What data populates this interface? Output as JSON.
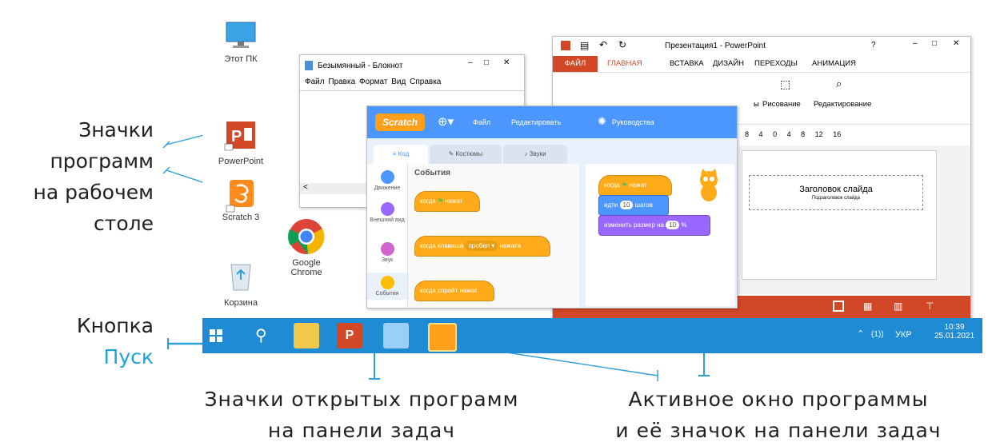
{
  "callouts": {
    "desktop_icons": [
      "Значки",
      "программ",
      "на рабочем",
      "столе"
    ],
    "start_button": [
      "Кнопка",
      "Пуск"
    ],
    "taskbar_icons": [
      "Значки открытых программ",
      "на панели задач"
    ],
    "active_window": [
      "Активное окно программы",
      "и её значок на панели задач"
    ]
  },
  "desktop": {
    "icons": [
      {
        "label": "Этот ПК",
        "icon": "computer-icon"
      },
      {
        "label": "PowerPoint",
        "icon": "powerpoint-icon"
      },
      {
        "label": "Scratch 3",
        "icon": "scratch-icon"
      },
      {
        "label": "Google Chrome",
        "icon": "chrome-icon"
      },
      {
        "label": "Корзина",
        "icon": "recycle-bin-icon"
      }
    ]
  },
  "notepad": {
    "title": "Безымянный - Блокнот",
    "menu": [
      "Файл",
      "Правка",
      "Формат",
      "Вид",
      "Справка"
    ]
  },
  "powerpoint": {
    "title": "Презентация1 - PowerPoint",
    "tabs": [
      "ФАЙЛ",
      "ГЛАВНАЯ",
      "ВСТАВКА",
      "ДИЗАЙН",
      "ПЕРЕХОДЫ",
      "АНИМАЦИЯ"
    ],
    "groups": [
      "Рисование",
      "Редактирование"
    ],
    "ruler": [
      "8",
      "4",
      "0",
      "4",
      "8",
      "12",
      "16"
    ],
    "slide_title": "Заголовок слайда",
    "slide_subtitle": "Подзаголовок слайда",
    "partial_group": "ы"
  },
  "scratch": {
    "logo": "Scratch",
    "menu": [
      "Файл",
      "Редактировать",
      "Руководства"
    ],
    "tabs": [
      "Код",
      "Костюмы",
      "Звуки"
    ],
    "categories": [
      {
        "label": "Движение",
        "color": "#4c97ff"
      },
      {
        "label": "Внешний вид",
        "color": "#9966ff"
      },
      {
        "label": "Звук",
        "color": "#cf63cf"
      },
      {
        "label": "События",
        "color": "#ffbf00"
      }
    ],
    "palette_title": "События",
    "palette_blocks": [
      "когда",
      "нажат",
      "когда клавиша",
      "пробел",
      "нажата",
      "когда спрайт нажат"
    ],
    "script": {
      "hat": [
        "когда",
        "нажат"
      ],
      "move": [
        "идти",
        "10",
        "шагов"
      ],
      "size": [
        "изменить размер на",
        "10",
        "%"
      ]
    }
  },
  "taskbar": {
    "lang": "УКР",
    "time": "10:39",
    "date": "25.01.2021",
    "volume": "(1))"
  }
}
